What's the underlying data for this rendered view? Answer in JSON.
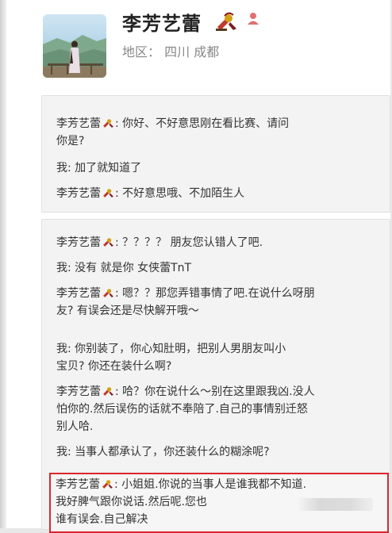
{
  "profile": {
    "name": "李芳艺蕾",
    "region_label": "地区：",
    "region_value": "四川 成都"
  },
  "colors": {
    "highlight": "#d9262b",
    "badge": "#c0392b"
  },
  "icons": {
    "name_badge": "wukong-emoji-icon",
    "user": "user-icon"
  },
  "conversation": [
    {
      "speaker": "李芳艺蕾",
      "text": ": 你好、不好意思刚在看比赛、请问",
      "text2": "你是?"
    },
    {
      "speaker": "我",
      "text": ": 加了就知道了"
    },
    {
      "speaker": "李芳艺蕾",
      "text": ": 不好意思哦、不加陌生人"
    },
    {
      "speaker": "李芳艺蕾",
      "text": ": ？？？？ 朋友您认错人了吧."
    },
    {
      "speaker": "我",
      "text": ": 没有 就是你 女侠蕾TnT"
    },
    {
      "speaker": "李芳艺蕾",
      "text": ": 嗯？？那您弄错事情了吧.在说什么呀朋",
      "text2": "友? 有误会还是尽快解开哦～"
    },
    {
      "speaker": "我",
      "text": ": 你别装了，你心知肚明，把别人男朋友叫小",
      "text2": "宝贝? 你还在装什么啊?"
    },
    {
      "speaker": "李芳艺蕾",
      "text": ": 哈？你在说什么～别在这里跟我凶.没人",
      "text2": "怕你的.然后误伤的话就不奉陪了.自己的事情别迁怒",
      "text3": "别人哈."
    },
    {
      "speaker": "我",
      "text": ": 当事人都承认了，你还装什么的糊涂呢?"
    },
    {
      "speaker": "李芳艺蕾",
      "text": ": 小姐姐.你说的当事人是谁我都不知道.",
      "text2": "我好脾气跟你说话.然后呢.您也",
      "text3": "谁有误会.自己解决"
    }
  ]
}
